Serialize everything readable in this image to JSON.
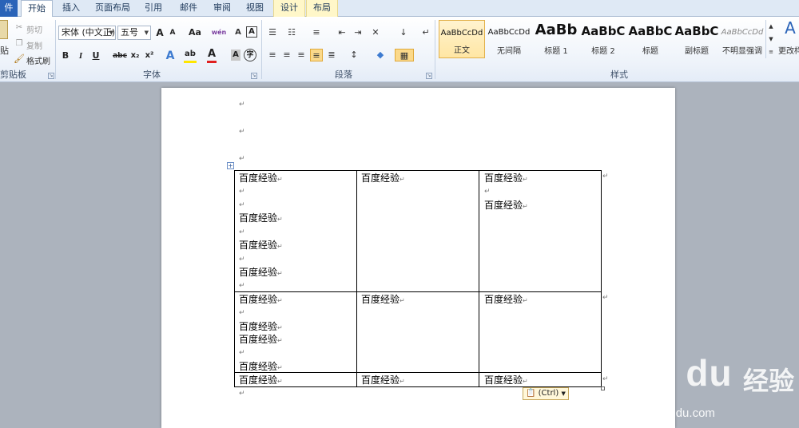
{
  "tabs": [
    {
      "label": "件"
    },
    {
      "label": "开始"
    },
    {
      "label": "插入"
    },
    {
      "label": "页面布局"
    },
    {
      "label": "引用"
    },
    {
      "label": "邮件"
    },
    {
      "label": "审阅"
    },
    {
      "label": "视图"
    },
    {
      "label": "设计"
    },
    {
      "label": "布局"
    }
  ],
  "clipboard": {
    "paste": "贴",
    "cut": "剪切",
    "copy": "复制",
    "format_painter": "格式刷",
    "group_label": "剪贴板"
  },
  "font": {
    "name": "宋体 (中文正)",
    "size": "五号",
    "grow": "A",
    "shrink": "A",
    "change_case": "Aa",
    "pinyin": "wén",
    "char_border": "A",
    "bold": "B",
    "italic": "I",
    "underline": "U",
    "strike": "abc",
    "subscript": "x₂",
    "superscript": "x²",
    "text_effect": "A",
    "highlight": "ab",
    "font_color": "A",
    "char_shading": "A",
    "enclose": "字",
    "group_label": "字体"
  },
  "paragraph": {
    "group_label": "段落"
  },
  "styles": {
    "group_label": "样式",
    "change_styles": "更改样",
    "items": [
      {
        "sample": "AaBbCcDd",
        "name": "正文"
      },
      {
        "sample": "AaBbCcDd",
        "name": "无间隔"
      },
      {
        "sample": "AaBb",
        "name": "标题 1"
      },
      {
        "sample": "AaBbC",
        "name": "标题 2"
      },
      {
        "sample": "AaBbC",
        "name": "标题"
      },
      {
        "sample": "AaBbC",
        "name": "副标题"
      },
      {
        "sample": "AaBbCcDd",
        "name": "不明显强调"
      }
    ]
  },
  "document": {
    "cell_text": "百度经验",
    "pilcrow": "↵",
    "paste_options": "(Ctrl)",
    "rows": [
      {
        "cells": [
          [
            "百度经验",
            "",
            "",
            "百度经验",
            "",
            "百度经验",
            "",
            "百度经验",
            ""
          ],
          [
            "百度经验"
          ],
          [
            "百度经验",
            "",
            "百度经验"
          ]
        ]
      },
      {
        "cells": [
          [
            "百度经验",
            "",
            "百度经验",
            "百度经验",
            "",
            "百度经验"
          ],
          [
            "百度经验"
          ],
          [
            "百度经验"
          ]
        ]
      },
      {
        "cells": [
          [
            "百度经验"
          ],
          [
            "百度经验"
          ],
          [
            "百度经验"
          ]
        ]
      }
    ]
  },
  "watermark": {
    "logo": "Bai du",
    "jingyan": "经验",
    "url": "jingyan.baidu.com"
  },
  "colors": {
    "file_tab": "#2a63b8",
    "ribbon_bg": "#eef3fa",
    "context_tab": "#fff7c9",
    "selected_style": "#ffe6a4",
    "page_bg": "#ffffff",
    "workspace_bg": "#acb3bd"
  }
}
